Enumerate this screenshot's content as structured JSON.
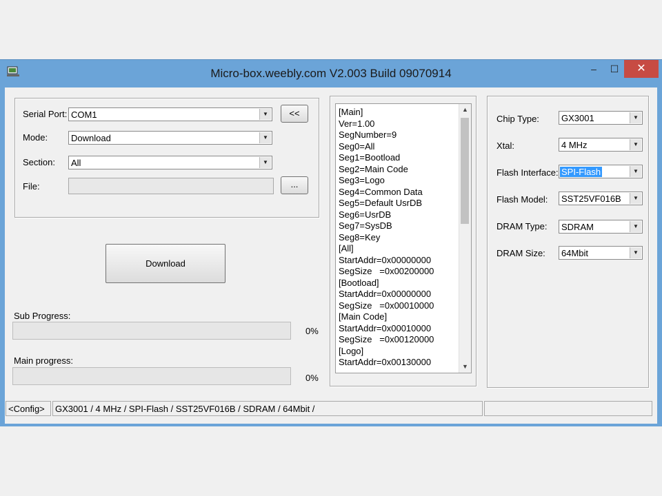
{
  "window": {
    "title": "Micro-box.weebly.com V2.003 Build 09070914",
    "controls": {
      "minimize": "‒",
      "maximize": "☐",
      "close": "✕"
    }
  },
  "left_panel": {
    "serial_port": {
      "label": "Serial Port:",
      "value": "COM1"
    },
    "mode": {
      "label": "Mode:",
      "value": "Download"
    },
    "section": {
      "label": "Section:",
      "value": "All"
    },
    "file": {
      "label": "File:",
      "value": ""
    },
    "collapse_button": "<<",
    "browse_button": "...",
    "download_button": "Download",
    "sub_progress": {
      "label": "Sub Progress:",
      "value": 0,
      "text": "0%"
    },
    "main_progress": {
      "label": "Main progress:",
      "value": 0,
      "text": "0%"
    }
  },
  "config_text": [
    "[Main]",
    "Ver=1.00",
    "SegNumber=9",
    "Seg0=All",
    "Seg1=Bootload",
    "Seg2=Main Code",
    "Seg3=Logo",
    "Seg4=Common Data",
    "Seg5=Default UsrDB",
    "Seg6=UsrDB",
    "Seg7=SysDB",
    "Seg8=Key",
    "[All]",
    "StartAddr=0x00000000",
    "SegSize   =0x00200000",
    "[Bootload]",
    "StartAddr=0x00000000",
    "SegSize   =0x00010000",
    "[Main Code]",
    "StartAddr=0x00010000",
    "SegSize   =0x00120000",
    "[Logo]",
    "StartAddr=0x00130000"
  ],
  "right_panel": {
    "chip_type": {
      "label": "Chip Type:",
      "value": "GX3001"
    },
    "xtal": {
      "label": "Xtal:",
      "value": "4 MHz"
    },
    "flash_interface": {
      "label": "Flash Interface:",
      "value": "SPI-Flash"
    },
    "flash_model": {
      "label": "Flash Model:",
      "value": "SST25VF016B"
    },
    "dram_type": {
      "label": "DRAM Type:",
      "value": "SDRAM"
    },
    "dram_size": {
      "label": "DRAM Size:",
      "value": "64Mbit"
    }
  },
  "status_bar": {
    "config_button": "<Config>",
    "summary": "GX3001 / 4 MHz / SPI-Flash / SST25VF016B / SDRAM / 64Mbit /"
  },
  "colors": {
    "titlebar": "#6ba4d8",
    "close": "#c74b43",
    "selection": "#3399ff",
    "progress_fill": "#06b025"
  }
}
